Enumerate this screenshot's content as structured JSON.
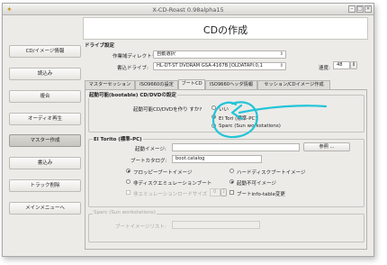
{
  "window": {
    "title": "X-CD-Roast 0.98alpha15"
  },
  "sidebar": {
    "items": [
      {
        "label": "CD/イメージ情報"
      },
      {
        "label": "読込み"
      },
      {
        "label": "複合"
      },
      {
        "label": "オーディオ再生"
      },
      {
        "label": "マスター作成"
      },
      {
        "label": "書込み"
      },
      {
        "label": "トラック削除"
      },
      {
        "label": "メインメニューへ"
      }
    ]
  },
  "main": {
    "heading": "CDの作成",
    "drive_section": "ドライブ設定",
    "workdir_label": "作業域ディレクトリ:",
    "workdir_value": "自動選択",
    "writer_label": "書込ドライブ:",
    "writer_value": "HL-DT-ST DVDRAM GSA-4167B [OLDATAPI:0,1",
    "speed_label": "速度:",
    "speed_value": "48"
  },
  "tabs": [
    {
      "label": "マスターセッション"
    },
    {
      "label": "ISO9660の設定"
    },
    {
      "label": "ブートCD"
    },
    {
      "label": "ISO9660ヘッダ情報"
    },
    {
      "label": "セッション/CDイメージ作成"
    }
  ],
  "bootcd": {
    "frame_title": "起動可能(bootable) CD/DVDの設定",
    "question": "起動可能CD/DVDを作り すか?",
    "options": [
      {
        "label": "いい"
      },
      {
        "label": "El Tori   (標準-PC)"
      },
      {
        "label": "Sparc (Sun workstations)"
      }
    ],
    "eltorito": {
      "title": "El Torito (標準-PC)",
      "boot_image_label": "起動イメージ:",
      "boot_image_value": "",
      "browse_label": "参照 ...",
      "boot_catalog_label": "ブートカタログ:",
      "boot_catalog_value": "boot.catalog",
      "floppy_label": "フロッピーブートイメージ",
      "harddisk_label": "ハードディスクブートイメージ",
      "noemul_label": "非ディスクエミュレーションブート",
      "nobootable_label": "起動不可イメージ",
      "loadsize_label": "非エミュレーションロードサイズ",
      "loadsize_value": "0",
      "bootinfo_label": "ブートinfo-table変更"
    },
    "sparc": {
      "title": "Sparc (Sun workstations)",
      "imagelist_label": "ブートイメージリスト:",
      "imagelist_value": ""
    }
  },
  "colors": {
    "annotation": "#22c4d8",
    "window_bg": "#ecebe8"
  }
}
